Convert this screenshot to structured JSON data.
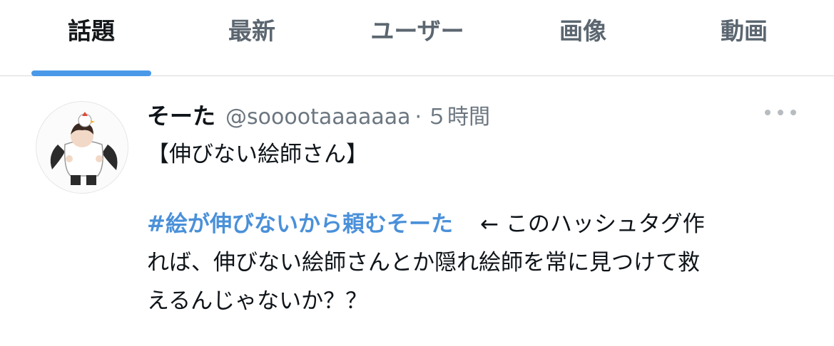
{
  "tabs": [
    {
      "label": "話題",
      "active": true
    },
    {
      "label": "最新",
      "active": false
    },
    {
      "label": "ユーザー",
      "active": false
    },
    {
      "label": "画像",
      "active": false
    },
    {
      "label": "動画",
      "active": false
    }
  ],
  "colors": {
    "accent": "#4a99e9",
    "hashtag": "#4a90d9",
    "muted_text": "#6b7680",
    "primary_text": "#0f1419"
  },
  "tweet": {
    "author_name": "そーた",
    "handle": "@sooootaaaaaaa",
    "separator": "·",
    "time": "５時間",
    "more_icon": "more-horizontal-icon",
    "body": {
      "line1": "【伸びない絵師さん】",
      "hashtag": "#絵が伸びないから頼むそーた",
      "line3_rest": "← このハッシュタグ作",
      "line4": "れば、伸びない絵師さんとか隠れ絵師を常に見つけて救",
      "line5": "えるんじゃないか？？"
    }
  }
}
